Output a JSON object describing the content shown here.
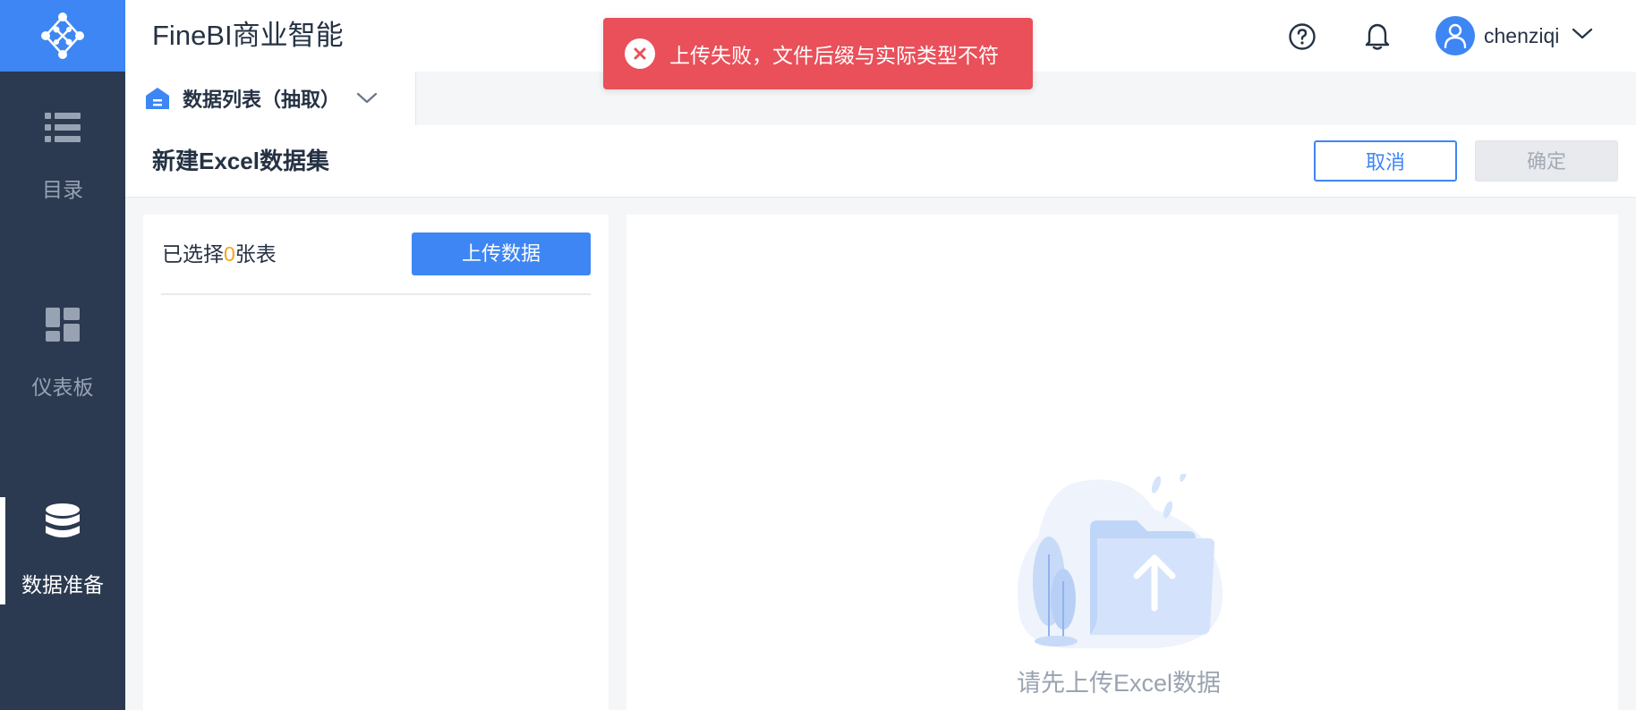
{
  "app": {
    "title": "FineBI商业智能"
  },
  "colors": {
    "primary": "#3d86f4",
    "sidebar": "#2b3a50",
    "error": "#e9505a",
    "count_highlight": "#f7a41e"
  },
  "sidebar": {
    "logo_icon": "finebi-logo-icon",
    "items": [
      {
        "label": "目录",
        "icon": "list-icon",
        "active": false
      },
      {
        "label": "仪表板",
        "icon": "dashboard-icon",
        "active": false
      },
      {
        "label": "数据准备",
        "icon": "database-icon",
        "active": true
      }
    ]
  },
  "header": {
    "help_icon": "help-icon",
    "notification_icon": "bell-icon",
    "user": {
      "name": "chenziqi",
      "avatar_icon": "user-icon"
    }
  },
  "tabs": [
    {
      "label": "数据列表（抽取）",
      "icon": "home-icon"
    }
  ],
  "toolbar": {
    "title": "新建Excel数据集",
    "cancel_label": "取消",
    "confirm_label": "确定"
  },
  "left_panel": {
    "selected_prefix": "已选择",
    "selected_count": "0",
    "selected_suffix": "张表",
    "upload_label": "上传数据"
  },
  "right_panel": {
    "empty_text": "请先上传Excel数据",
    "empty_icon": "folder-upload-icon"
  },
  "toast": {
    "message": "上传失败，文件后缀与实际类型不符",
    "icon": "error-icon"
  }
}
